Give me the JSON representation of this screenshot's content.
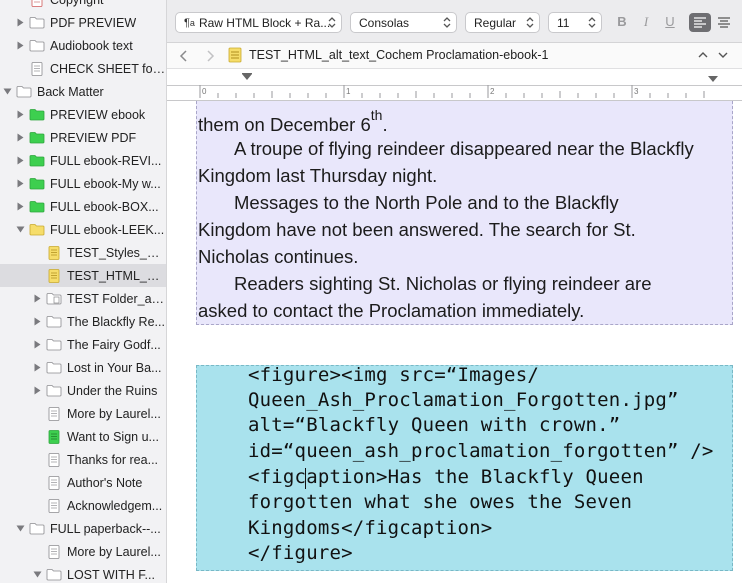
{
  "sidebar": {
    "items": [
      {
        "label": "Copyright",
        "icon": "doc-red-icon",
        "expander": "none"
      },
      {
        "label": "PDF PREVIEW",
        "icon": "folder-icon",
        "expander": "collapsed"
      },
      {
        "label": "Audiobook text",
        "icon": "folder-icon",
        "expander": "collapsed"
      },
      {
        "label": "CHECK SHEET for...",
        "icon": "doc-icon",
        "expander": "none"
      },
      {
        "label": "Back Matter",
        "icon": "folder-icon",
        "expander": "expanded"
      },
      {
        "label": "PREVIEW ebook",
        "icon": "folder-green-icon",
        "expander": "collapsed"
      },
      {
        "label": "PREVIEW PDF",
        "icon": "folder-green-icon",
        "expander": "collapsed"
      },
      {
        "label": "FULL ebook-REVI...",
        "icon": "folder-green-icon",
        "expander": "collapsed"
      },
      {
        "label": "FULL ebook-My w...",
        "icon": "folder-green-icon",
        "expander": "collapsed"
      },
      {
        "label": "FULL ebook-BOX...",
        "icon": "folder-green-icon",
        "expander": "collapsed"
      },
      {
        "label": "FULL ebook-LEEK...",
        "icon": "folder-yellow-icon",
        "expander": "expanded"
      },
      {
        "label": "TEST_Styles_al...",
        "icon": "doc-yellow-icon",
        "expander": "none"
      },
      {
        "label": "TEST_HTML_alt...",
        "icon": "doc-yellow-icon",
        "expander": "none"
      },
      {
        "label": "TEST Folder_alt...",
        "icon": "folder-doc-icon",
        "expander": "collapsed"
      },
      {
        "label": "The Blackfly Re...",
        "icon": "folder-icon",
        "expander": "collapsed"
      },
      {
        "label": "The Fairy Godf...",
        "icon": "folder-icon",
        "expander": "collapsed"
      },
      {
        "label": "Lost in Your Ba...",
        "icon": "folder-icon",
        "expander": "collapsed"
      },
      {
        "label": "Under the Ruins",
        "icon": "folder-icon",
        "expander": "collapsed"
      },
      {
        "label": "More by Laurel...",
        "icon": "doc-icon",
        "expander": "none"
      },
      {
        "label": "Want to Sign u...",
        "icon": "doc-green-icon",
        "expander": "none"
      },
      {
        "label": "Thanks for rea...",
        "icon": "doc-icon",
        "expander": "none"
      },
      {
        "label": "Author's Note",
        "icon": "doc-icon",
        "expander": "none"
      },
      {
        "label": "Acknowledgem...",
        "icon": "doc-icon",
        "expander": "none"
      },
      {
        "label": "FULL paperback--...",
        "icon": "folder-icon",
        "expander": "expanded"
      },
      {
        "label": "More by Laurel...",
        "icon": "doc-icon",
        "expander": "none"
      },
      {
        "label": "LOST WITH F...",
        "icon": "folder-icon",
        "expander": "expanded"
      }
    ]
  },
  "toolbar": {
    "paragraph_style": "Raw HTML Block + Ra...",
    "font_family": "Consolas",
    "font_style": "Regular",
    "font_size": "11",
    "bold_label": "B",
    "italic_label": "I",
    "underline_label": "U"
  },
  "nav": {
    "document_title": "TEST_HTML_alt_text_Cochem Proclamation-ebook-1"
  },
  "ruler": {
    "ticks": [
      "0",
      "1",
      "2",
      "3"
    ]
  },
  "editor": {
    "text_block": {
      "line1_main": "them on December 6",
      "line1_sup": "th",
      "line1_end": ".",
      "lines": [
        "A troupe of flying reindeer disappeared near the Blackfly",
        "Kingdom last Thursday night.",
        "Messages to the North Pole and to the Blackfly",
        "Kingdom have not been answered. The search for St.",
        "Nicholas continues.",
        "Readers sighting St. Nicholas or flying reindeer are",
        "asked to contact the Proclamation immediately."
      ]
    },
    "code_block": {
      "lines": [
        "<figure><img src=“Images/",
        "Queen_Ash_Proclamation_Forgotten.jpg”",
        "alt=“Blackfly Queen with crown.”",
        "id=“queen_ash_proclamation_forgotten” />",
        "<figcaption>Has the Blackfly Queen",
        "forgotten what she owes the Seven",
        "Kingdoms</figcaption>",
        "</figure>"
      ]
    }
  },
  "colors": {
    "text_block_bg": "#e9e7fb",
    "code_block_bg": "#a9e2ed",
    "folder_blue": "#8fa9c4",
    "folder_green": "#3dcf4f",
    "folder_yellow": "#f6dd6a"
  }
}
